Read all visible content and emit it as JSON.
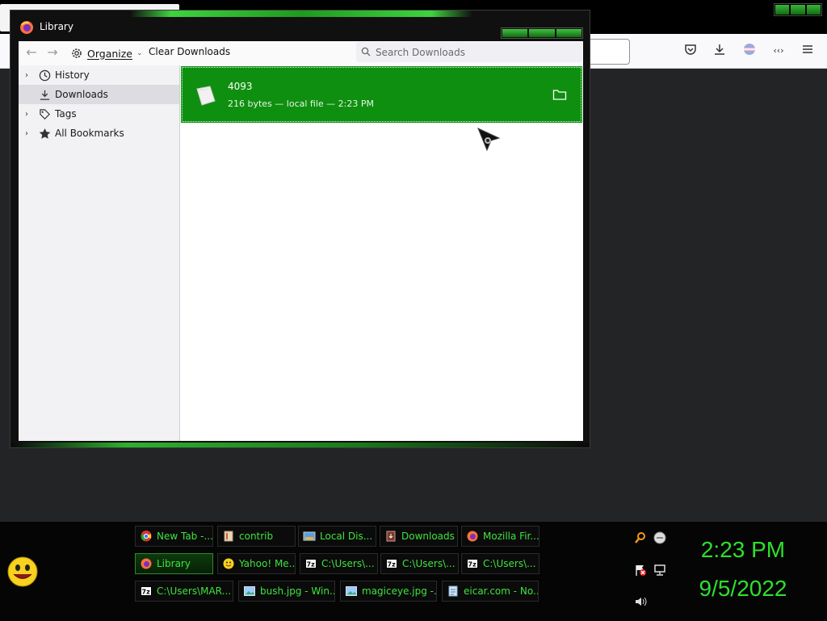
{
  "window": {
    "title": "Library"
  },
  "toolbar": {
    "organize_label": "Organize",
    "clear_label": "Clear Downloads",
    "search_placeholder": "Search Downloads"
  },
  "sidebar": {
    "items": [
      {
        "label": "History",
        "icon": "clock-icon",
        "expandable": true,
        "selected": false
      },
      {
        "label": "Downloads",
        "icon": "download-icon",
        "expandable": false,
        "selected": true
      },
      {
        "label": "Tags",
        "icon": "tag-icon",
        "expandable": true,
        "selected": false
      },
      {
        "label": "All Bookmarks",
        "icon": "star-icon",
        "expandable": true,
        "selected": false
      }
    ]
  },
  "downloads": [
    {
      "name": "4093",
      "meta": "216 bytes — local file — 2:23 PM",
      "selected": true
    }
  ],
  "taskbar": {
    "rows": [
      [
        {
          "label": "New Tab -...",
          "icon": "chrome-icon"
        },
        {
          "label": "contrib",
          "icon": "folder-icon"
        },
        {
          "label": "Local Dis...",
          "icon": "drive-icon"
        },
        {
          "label": "Downloads",
          "icon": "downloads-folder-icon"
        },
        {
          "label": "Mozilla Fir...",
          "icon": "firefox-icon"
        }
      ],
      [
        {
          "label": "Library",
          "icon": "firefox-icon",
          "active": true
        },
        {
          "label": "Yahoo! Me...",
          "icon": "yahoo-messenger-icon"
        },
        {
          "label": "C:\\Users\\...",
          "icon": "7zip-icon"
        },
        {
          "label": "C:\\Users\\...",
          "icon": "7zip-icon"
        },
        {
          "label": "C:\\Users\\...",
          "icon": "7zip-icon"
        }
      ],
      [
        {
          "label": "C:\\Users\\MAR...",
          "icon": "7zip-icon"
        },
        {
          "label": "bush.jpg - Win...",
          "icon": "image-viewer-icon"
        },
        {
          "label": "magiceye.jpg -...",
          "icon": "image-viewer-icon"
        },
        {
          "label": "eicar.com - No...",
          "icon": "notepad-icon"
        }
      ]
    ],
    "time": "2:23 PM",
    "date": "9/5/2022"
  },
  "colors": {
    "accent_green": "#0f8f0f",
    "taskbar_text": "#3ee43e",
    "clock_text": "#2de02d"
  }
}
